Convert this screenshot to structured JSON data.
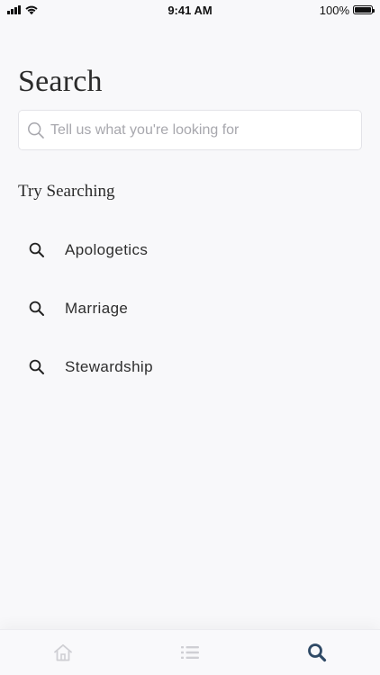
{
  "status_bar": {
    "time": "9:41 AM",
    "battery_percent": "100%",
    "battery_level": 1.0
  },
  "page": {
    "title": "Search"
  },
  "search": {
    "placeholder": "Tell us what you're looking for",
    "value": "",
    "icon": "search-icon"
  },
  "suggestions": {
    "title": "Try Searching",
    "items": [
      {
        "label": "Apologetics",
        "icon": "search-icon"
      },
      {
        "label": "Marriage",
        "icon": "search-icon"
      },
      {
        "label": "Stewardship",
        "icon": "search-icon"
      }
    ]
  },
  "tab_bar": {
    "tabs": [
      {
        "name": "home",
        "icon": "home-icon",
        "active": false
      },
      {
        "name": "list",
        "icon": "list-icon",
        "active": false
      },
      {
        "name": "search",
        "icon": "search-icon",
        "active": true
      }
    ],
    "colors": {
      "active": "#2f4a66",
      "inactive": "#cfcfd4"
    }
  }
}
